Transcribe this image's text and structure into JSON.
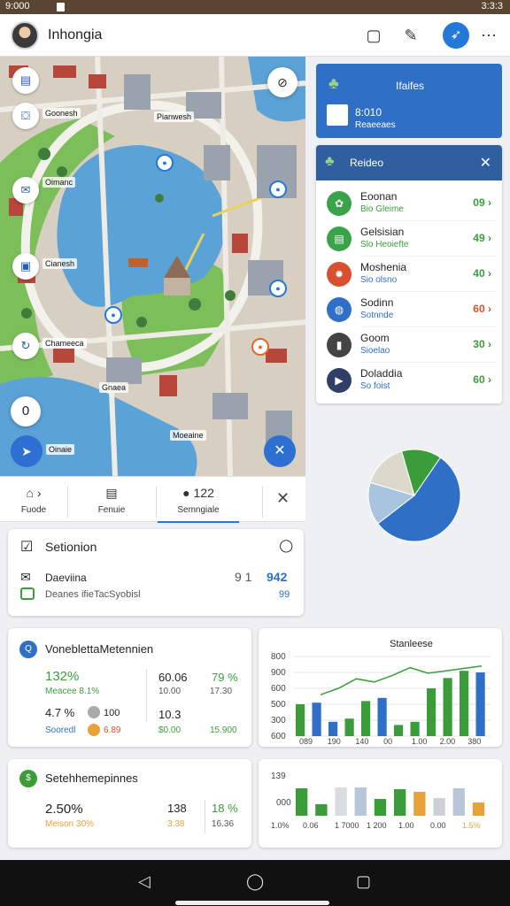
{
  "status_bar": {
    "left": "9:000",
    "right": "3:3:3"
  },
  "app_bar": {
    "title": "Inhongia",
    "icons": [
      "square-icon",
      "edit-icon",
      "compass-icon",
      "more-icon"
    ]
  },
  "map": {
    "labels": [
      "Goonesh",
      "Oimanc",
      "Cianesh",
      "Chameeca",
      "Pianwesh",
      "Gnaea",
      "Moeaine"
    ],
    "pin_label": "Oinaie",
    "side_icons": [
      "list-icon",
      "bag-icon",
      "chat-icon",
      "photo-icon",
      "refresh-icon"
    ]
  },
  "tabs": [
    {
      "icon": "home-icon",
      "label": "Fuode"
    },
    {
      "icon": "doc-icon",
      "label": "Fenuie"
    },
    {
      "icon": "pin-icon",
      "label": "Semngiale",
      "value": "122"
    }
  ],
  "settings_card": {
    "title": "Setionion",
    "row_label": "Daeviina",
    "row_sub": "Deanes ifieTacSyobisl",
    "value_a": "9 1",
    "value_b": "942",
    "value_c": "99"
  },
  "stats_card_1": {
    "title": "VoneblettaMetennien",
    "pct1": "132%",
    "pct1_sub": "Meacee 8.1%",
    "mid1": "60.06",
    "mid1_sub": "10.00",
    "right1": "79 %",
    "right1_sub": "17.30",
    "pct2": "4.7 %",
    "coin_val": "100",
    "mid2": "10.3",
    "sub_a": "Sooredl",
    "sub_b": "6.89",
    "sub_c": "$0.00",
    "sub_d": "15.900"
  },
  "stats_card_2": {
    "title": "Setehhemepinnes",
    "pct": "2.50%",
    "pct_sub": "Meison 30%",
    "mid": "138",
    "mid_sub": "3.38",
    "right": "18 %",
    "right_sub": "16.36"
  },
  "blue_card": {
    "title": "Ifaifes",
    "value": "8:010",
    "sub": "Reaeeaes"
  },
  "panel": {
    "title": "Reideo",
    "items": [
      {
        "title": "Eoonan",
        "sub": "Bio Gleime",
        "value": "09",
        "icon": "leaf-icon",
        "color": "#3aa34a",
        "sub_color": "#3a9d3a",
        "value_color": "#3a9d3a"
      },
      {
        "title": "Gelsisian",
        "sub": "Slo Heoiefte",
        "value": "49",
        "icon": "doc-icon",
        "color": "#3aa34a",
        "sub_color": "#3a9d3a",
        "value_color": "#3a9d3a"
      },
      {
        "title": "Moshenia",
        "sub": "Sio olsno",
        "value": "40",
        "icon": "gear-icon",
        "color": "#d8502f",
        "sub_color": "#2f6fc6",
        "value_color": "#3a9d3a"
      },
      {
        "title": "Sodinn",
        "sub": "Sotnnde",
        "value": "60",
        "icon": "globe-icon",
        "color": "#2f6fc6",
        "sub_color": "#2f6fc6",
        "value_color": "#d8502f"
      },
      {
        "title": "Goom",
        "sub": "Sioelao",
        "value": "30",
        "icon": "trash-icon",
        "color": "#444",
        "sub_color": "#2f6fc6",
        "value_color": "#3a9d3a"
      },
      {
        "title": "Doladdia",
        "sub": "So foist",
        "value": "60",
        "icon": "video-icon",
        "color": "#2f3f66",
        "sub_color": "#2f6fc6",
        "value_color": "#3a9d3a"
      }
    ]
  },
  "pie": {
    "slices": [
      {
        "value": 55,
        "color": "#2f6fc6"
      },
      {
        "value": 15,
        "color": "#a9c4de"
      },
      {
        "value": 16,
        "color": "#dcd9cc"
      },
      {
        "value": 14,
        "color": "#3a9d3a"
      }
    ]
  },
  "chart_data": [
    {
      "type": "bar",
      "title": "Stanleese",
      "y_ticks": [
        "800",
        "900",
        "600",
        "500",
        "300",
        "600"
      ],
      "x_ticks": [
        "089",
        "190",
        "140",
        "00",
        "1.00",
        "2.00",
        "380"
      ],
      "bars": [
        {
          "value": 40,
          "color": "#3a9d3a"
        },
        {
          "value": 42,
          "color": "#2f6fc6"
        },
        {
          "value": 18,
          "color": "#2f6fc6"
        },
        {
          "value": 22,
          "color": "#3a9d3a"
        },
        {
          "value": 44,
          "color": "#3a9d3a"
        },
        {
          "value": 48,
          "color": "#2f6fc6"
        },
        {
          "value": 14,
          "color": "#3a9d3a"
        },
        {
          "value": 18,
          "color": "#3a9d3a"
        },
        {
          "value": 60,
          "color": "#3a9d3a"
        },
        {
          "value": 73,
          "color": "#3a9d3a"
        },
        {
          "value": 82,
          "color": "#3a9d3a"
        },
        {
          "value": 80,
          "color": "#2f6fc6"
        }
      ],
      "line": [
        52,
        60,
        72,
        68,
        76,
        86,
        79,
        82,
        85,
        88
      ],
      "ylim": [
        0,
        100
      ]
    },
    {
      "type": "bar",
      "y_ticks": [
        "139",
        "000"
      ],
      "x_ticks": [
        "1.0%",
        "0.06",
        "1 7000",
        "1 200",
        "1.00",
        "0.00",
        "1.5%"
      ],
      "bars": [
        {
          "value": 62,
          "color": "#3a9d3a"
        },
        {
          "value": 26,
          "color": "#3a9d3a"
        },
        {
          "value": 64,
          "color": "#d9dce0"
        },
        {
          "value": 64,
          "color": "#b8c6d8"
        },
        {
          "value": 38,
          "color": "#3a9d3a"
        },
        {
          "value": 60,
          "color": "#3a9d3a"
        },
        {
          "value": 54,
          "color": "#e8a23a"
        },
        {
          "value": 40,
          "color": "#cdd0d4"
        },
        {
          "value": 62,
          "color": "#b8c6d8"
        },
        {
          "value": 30,
          "color": "#e8a23a"
        }
      ],
      "ylim": [
        0,
        100
      ]
    }
  ]
}
